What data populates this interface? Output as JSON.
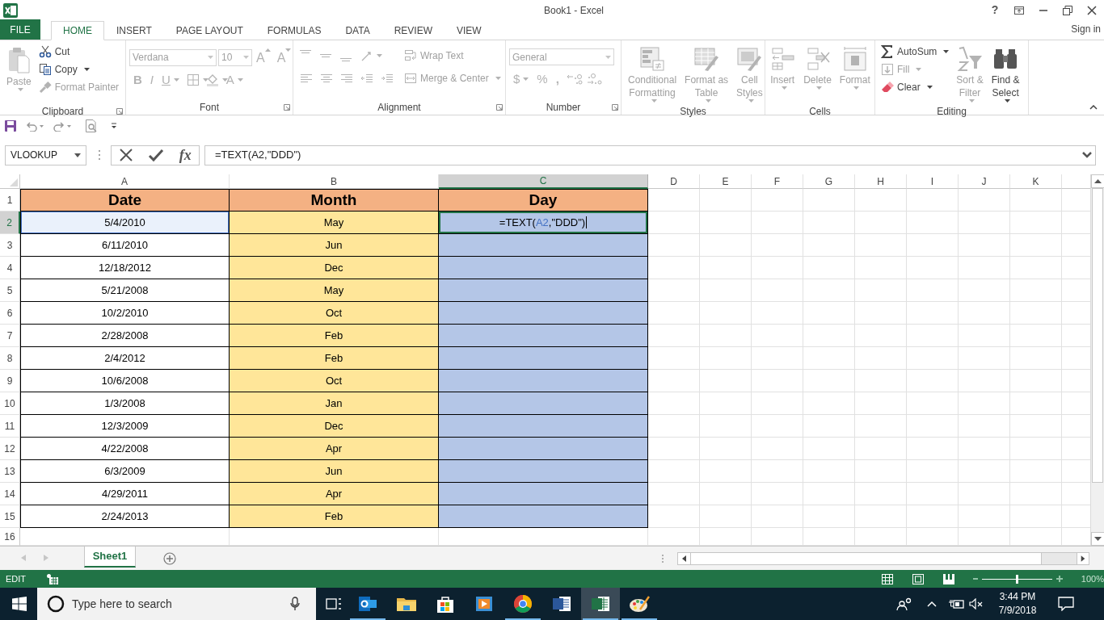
{
  "window": {
    "title": "Book1 - Excel",
    "help": "?"
  },
  "tabs": [
    {
      "label": "FILE",
      "kind": "file",
      "selected": false
    },
    {
      "label": "HOME",
      "kind": "tab",
      "selected": true
    },
    {
      "label": "INSERT",
      "kind": "tab",
      "selected": false
    },
    {
      "label": "PAGE LAYOUT",
      "kind": "tab",
      "selected": false
    },
    {
      "label": "FORMULAS",
      "kind": "tab",
      "selected": false
    },
    {
      "label": "DATA",
      "kind": "tab",
      "selected": false
    },
    {
      "label": "REVIEW",
      "kind": "tab",
      "selected": false
    },
    {
      "label": "VIEW",
      "kind": "tab",
      "selected": false
    }
  ],
  "sign_in": "Sign in",
  "ribbon": {
    "groups": [
      {
        "label": "Clipboard",
        "items": [
          {
            "kind": "large",
            "lines": [
              "Paste"
            ],
            "disabled": true
          },
          {
            "kind": "small",
            "label": "Cut",
            "disabled": false
          },
          {
            "kind": "small",
            "label": "Copy",
            "disabled": false
          },
          {
            "kind": "small",
            "label": "Format Painter",
            "disabled": true
          }
        ]
      },
      {
        "label": "Font",
        "items": [
          {
            "kind": "field",
            "value": "Verdana",
            "disabled": true
          },
          {
            "kind": "field",
            "value": "10",
            "disabled": true
          },
          {
            "kind": "glyph",
            "label": "A",
            "disabled": true
          },
          {
            "kind": "glyph",
            "label": "A",
            "disabled": true
          },
          {
            "kind": "glyph",
            "label": "B",
            "disabled": true
          },
          {
            "kind": "glyph",
            "label": "I",
            "disabled": true
          },
          {
            "kind": "glyph",
            "label": "U",
            "disabled": true
          },
          {
            "kind": "icon",
            "disabled": true
          },
          {
            "kind": "icon",
            "disabled": true
          },
          {
            "kind": "glyph",
            "label": "A",
            "disabled": true
          }
        ]
      },
      {
        "label": "Alignment",
        "items": [
          {
            "kind": "icon",
            "disabled": true
          },
          {
            "kind": "icon",
            "disabled": true
          },
          {
            "kind": "icon",
            "disabled": true
          },
          {
            "kind": "icon",
            "disabled": true
          },
          {
            "kind": "icon",
            "disabled": true
          },
          {
            "kind": "icon",
            "disabled": true
          },
          {
            "kind": "icon",
            "disabled": true
          },
          {
            "kind": "icon",
            "disabled": true
          },
          {
            "kind": "icon",
            "disabled": true
          },
          {
            "kind": "small",
            "label": "Wrap Text",
            "disabled": true
          },
          {
            "kind": "small",
            "label": "Merge & Center",
            "disabled": true
          }
        ]
      },
      {
        "label": "Number",
        "items": [
          {
            "kind": "field",
            "value": "General",
            "disabled": true
          },
          {
            "kind": "glyph",
            "label": "$",
            "disabled": true
          },
          {
            "kind": "glyph",
            "label": "%",
            "disabled": true
          },
          {
            "kind": "glyph",
            "label": ",",
            "disabled": true
          },
          {
            "kind": "icon",
            "disabled": true
          },
          {
            "kind": "icon",
            "disabled": true
          }
        ]
      },
      {
        "label": "Styles",
        "items": [
          {
            "kind": "large",
            "lines": [
              "Conditional",
              "Formatting"
            ],
            "disabled": true
          },
          {
            "kind": "large",
            "lines": [
              "Format as",
              "Table"
            ],
            "disabled": true
          },
          {
            "kind": "large",
            "lines": [
              "Cell",
              "Styles"
            ],
            "disabled": true
          }
        ]
      },
      {
        "label": "Cells",
        "items": [
          {
            "kind": "large",
            "lines": [
              "Insert"
            ],
            "disabled": true
          },
          {
            "kind": "large",
            "lines": [
              "Delete"
            ],
            "disabled": true
          },
          {
            "kind": "large",
            "lines": [
              "Format"
            ],
            "disabled": true
          }
        ]
      },
      {
        "label": "Editing",
        "items": [
          {
            "kind": "small",
            "label": "AutoSum",
            "disabled": false
          },
          {
            "kind": "small",
            "label": "Fill",
            "disabled": true
          },
          {
            "kind": "small",
            "label": "Clear",
            "disabled": false
          },
          {
            "kind": "large",
            "lines": [
              "Sort &",
              "Filter"
            ],
            "disabled": true
          },
          {
            "kind": "large",
            "lines": [
              "Find &",
              "Select"
            ],
            "disabled": false
          }
        ]
      }
    ]
  },
  "formula_bar": {
    "name_box": "VLOOKUP",
    "fx": "fx",
    "formula": "=TEXT(A2,\"DDD\")"
  },
  "sheet": {
    "columns": [
      {
        "label": "A",
        "selected": false
      },
      {
        "label": "B",
        "selected": false
      },
      {
        "label": "C",
        "selected": true
      },
      {
        "label": "D",
        "selected": false
      },
      {
        "label": "E",
        "selected": false
      },
      {
        "label": "F",
        "selected": false
      },
      {
        "label": "G",
        "selected": false
      },
      {
        "label": "H",
        "selected": false
      },
      {
        "label": "I",
        "selected": false
      },
      {
        "label": "J",
        "selected": false
      },
      {
        "label": "K",
        "selected": false
      }
    ],
    "rows": [
      {
        "number": "1",
        "selected": false,
        "cells": [
          {
            "kind": "header",
            "text": "Date"
          },
          {
            "kind": "header",
            "text": "Month"
          },
          {
            "kind": "header",
            "text": "Day"
          }
        ]
      },
      {
        "number": "2",
        "selected": true,
        "cells": [
          {
            "kind": "reference",
            "text": "5/4/2010"
          },
          {
            "kind": "value",
            "text": "May"
          },
          {
            "kind": "editing",
            "segments": [
              {
                "text": "=TEXT("
              },
              {
                "text": "A2",
                "kind": "reference"
              },
              {
                "text": ",\"DDD\")"
              }
            ]
          }
        ]
      },
      {
        "number": "3",
        "selected": false,
        "cells": [
          {
            "kind": "value",
            "text": "6/11/2010"
          },
          {
            "kind": "value",
            "text": "Jun"
          },
          {
            "kind": "empty"
          }
        ]
      },
      {
        "number": "4",
        "selected": false,
        "cells": [
          {
            "kind": "value",
            "text": "12/18/2012"
          },
          {
            "kind": "value",
            "text": "Dec"
          },
          {
            "kind": "empty"
          }
        ]
      },
      {
        "number": "5",
        "selected": false,
        "cells": [
          {
            "kind": "value",
            "text": "5/21/2008"
          },
          {
            "kind": "value",
            "text": "May"
          },
          {
            "kind": "empty"
          }
        ]
      },
      {
        "number": "6",
        "selected": false,
        "cells": [
          {
            "kind": "value",
            "text": "10/2/2010"
          },
          {
            "kind": "value",
            "text": "Oct"
          },
          {
            "kind": "empty"
          }
        ]
      },
      {
        "number": "7",
        "selected": false,
        "cells": [
          {
            "kind": "value",
            "text": "2/28/2008"
          },
          {
            "kind": "value",
            "text": "Feb"
          },
          {
            "kind": "empty"
          }
        ]
      },
      {
        "number": "8",
        "selected": false,
        "cells": [
          {
            "kind": "value",
            "text": "2/4/2012"
          },
          {
            "kind": "value",
            "text": "Feb"
          },
          {
            "kind": "empty"
          }
        ]
      },
      {
        "number": "9",
        "selected": false,
        "cells": [
          {
            "kind": "value",
            "text": "10/6/2008"
          },
          {
            "kind": "value",
            "text": "Oct"
          },
          {
            "kind": "empty"
          }
        ]
      },
      {
        "number": "10",
        "selected": false,
        "cells": [
          {
            "kind": "value",
            "text": "1/3/2008"
          },
          {
            "kind": "value",
            "text": "Jan"
          },
          {
            "kind": "empty"
          }
        ]
      },
      {
        "number": "11",
        "selected": false,
        "cells": [
          {
            "kind": "value",
            "text": "12/3/2009"
          },
          {
            "kind": "value",
            "text": "Dec"
          },
          {
            "kind": "empty"
          }
        ]
      },
      {
        "number": "12",
        "selected": false,
        "cells": [
          {
            "kind": "value",
            "text": "4/22/2008"
          },
          {
            "kind": "value",
            "text": "Apr"
          },
          {
            "kind": "empty"
          }
        ]
      },
      {
        "number": "13",
        "selected": false,
        "cells": [
          {
            "kind": "value",
            "text": "6/3/2009"
          },
          {
            "kind": "value",
            "text": "Jun"
          },
          {
            "kind": "empty"
          }
        ]
      },
      {
        "number": "14",
        "selected": false,
        "cells": [
          {
            "kind": "value",
            "text": "4/29/2011"
          },
          {
            "kind": "value",
            "text": "Apr"
          },
          {
            "kind": "empty"
          }
        ]
      },
      {
        "number": "15",
        "selected": false,
        "cells": [
          {
            "kind": "value",
            "text": "2/24/2013"
          },
          {
            "kind": "value",
            "text": "Feb"
          },
          {
            "kind": "empty"
          }
        ]
      },
      {
        "number": "16",
        "selected": false
      }
    ]
  },
  "sheet_tabs": [
    {
      "label": "Sheet1",
      "selected": true
    }
  ],
  "status_bar": {
    "mode": "EDIT",
    "zoom": {
      "level": 0.5,
      "reading": "100%"
    }
  },
  "taskbar": {
    "search_placeholder": "Type here to search",
    "apps": [
      {
        "running": true,
        "selected": false
      },
      {
        "running": false,
        "selected": false
      },
      {
        "running": false,
        "selected": false
      },
      {
        "running": false,
        "selected": false
      },
      {
        "running": true,
        "selected": false
      },
      {
        "running": false,
        "selected": false
      },
      {
        "running": true,
        "selected": true
      },
      {
        "running": true,
        "selected": false
      }
    ],
    "time": "3:44 PM",
    "date": "7/9/2018"
  }
}
